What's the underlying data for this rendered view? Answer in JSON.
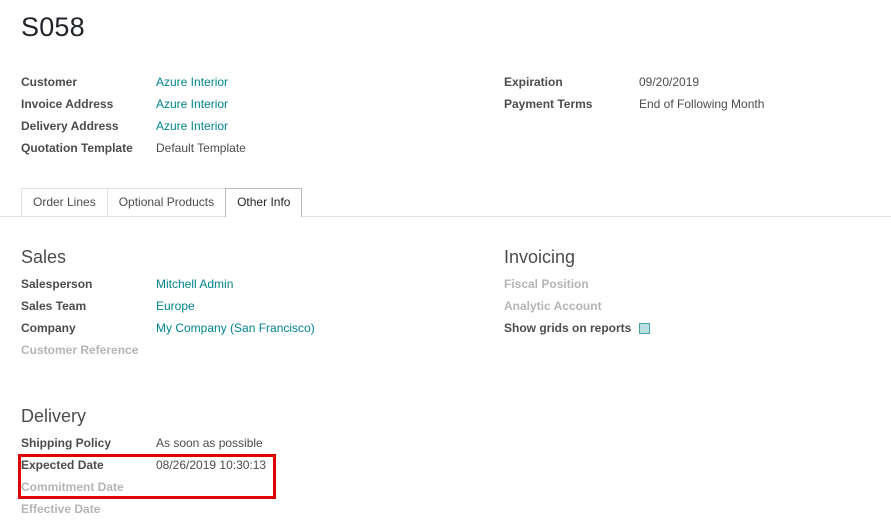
{
  "record": {
    "title": "S058"
  },
  "header": {
    "left": [
      {
        "label": "Customer",
        "value": "Azure Interior",
        "link": true
      },
      {
        "label": "Invoice Address",
        "value": "Azure Interior",
        "link": true
      },
      {
        "label": "Delivery Address",
        "value": "Azure Interior",
        "link": true
      },
      {
        "label": "Quotation Template",
        "value": "Default Template",
        "link": false
      }
    ],
    "right": [
      {
        "label": "Expiration",
        "value": "09/20/2019"
      },
      {
        "label": "Payment Terms",
        "value": "End of Following Month"
      }
    ]
  },
  "tabs": [
    {
      "label": "Order Lines",
      "active": false
    },
    {
      "label": "Optional Products",
      "active": false
    },
    {
      "label": "Other Info",
      "active": true
    }
  ],
  "sales": {
    "title": "Sales",
    "fields": [
      {
        "label": "Salesperson",
        "value": "Mitchell Admin"
      },
      {
        "label": "Sales Team",
        "value": "Europe"
      },
      {
        "label": "Company",
        "value": "My Company (San Francisco)"
      },
      {
        "label": "Customer Reference",
        "value": ""
      }
    ]
  },
  "invoicing": {
    "title": "Invoicing",
    "fields": [
      {
        "label": "Fiscal Position"
      },
      {
        "label": "Analytic Account"
      },
      {
        "label": "Show grids on reports",
        "checked": true
      }
    ]
  },
  "delivery": {
    "title": "Delivery",
    "fields": [
      {
        "label": "Shipping Policy",
        "value": "As soon as possible"
      },
      {
        "label": "Expected Date",
        "value": "08/26/2019 10:30:13"
      },
      {
        "label": "Commitment Date",
        "value": ""
      },
      {
        "label": "Effective Date",
        "value": ""
      }
    ]
  },
  "colors": {
    "link": "#00838f",
    "highlight_border": "#e00000",
    "checkbox_fill": "#b9e0e2"
  }
}
